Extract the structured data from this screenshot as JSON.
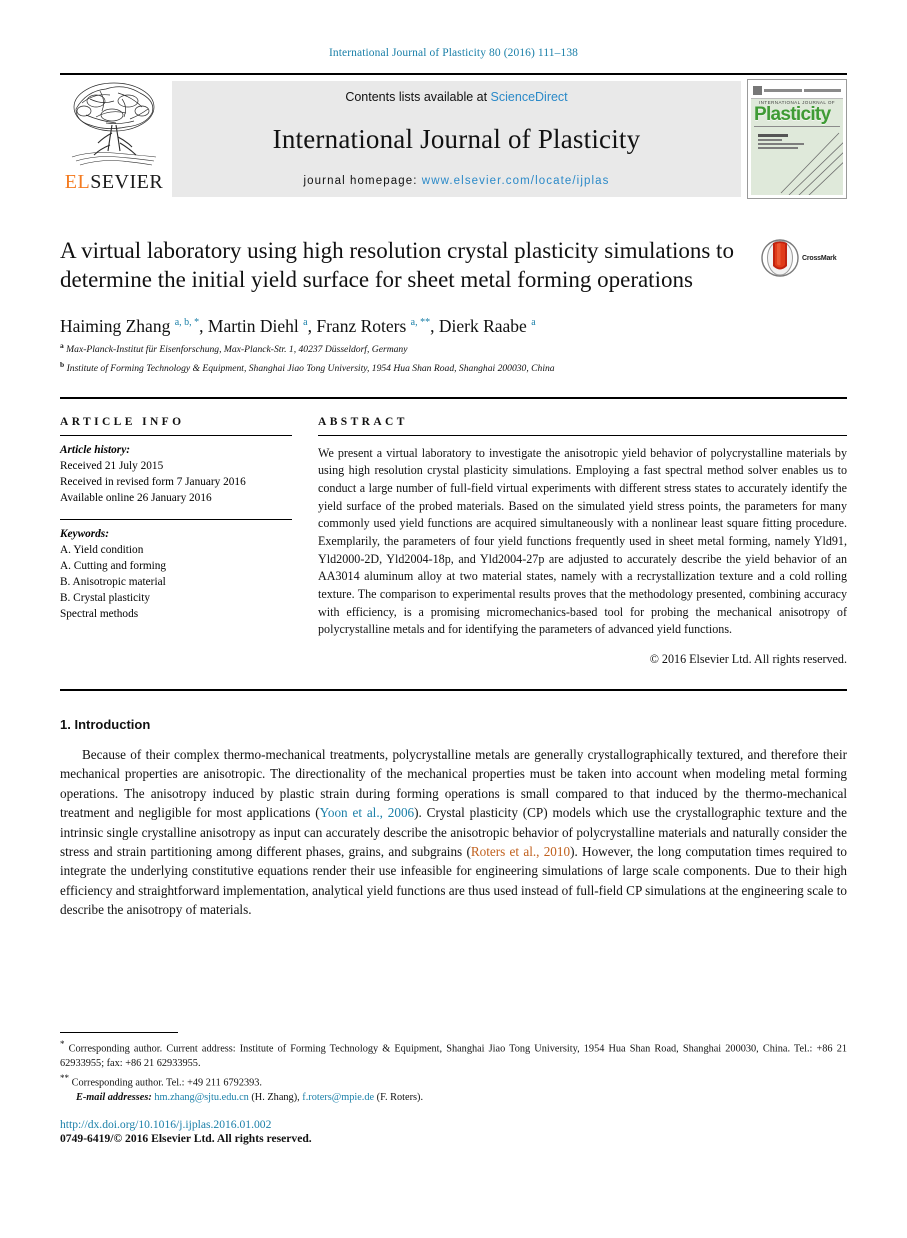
{
  "running_head": "International Journal of Plasticity 80 (2016) 111–138",
  "masthead": {
    "publisher": "ELSEVIER",
    "contents_prefix": "Contents lists available at ",
    "contents_link": "ScienceDirect",
    "journal_title": "International Journal of Plasticity",
    "homepage_prefix": "journal homepage: ",
    "homepage_url": "www.elsevier.com/locate/ijplas",
    "cover": {
      "kicker": "INTERNATIONAL JOURNAL OF",
      "name": "Plasticity"
    }
  },
  "article": {
    "title": "A virtual laboratory using high resolution crystal plasticity simulations to determine the initial yield surface for sheet metal forming operations",
    "crossmark_label": "CrossMark",
    "authors_html": "Haiming Zhang <sup>a, b, *</sup>, Martin Diehl <sup>a</sup>, Franz Roters <sup>a, **</sup>, Dierk Raabe <sup>a</sup>",
    "affiliations": [
      {
        "marker": "a",
        "text": "Max-Planck-Institut für Eisenforschung, Max-Planck-Str. 1, 40237 Düsseldorf, Germany"
      },
      {
        "marker": "b",
        "text": "Institute of Forming Technology & Equipment, Shanghai Jiao Tong University, 1954 Hua Shan Road, Shanghai 200030, China"
      }
    ]
  },
  "info": {
    "heading": "ARTICLE INFO",
    "history_label": "Article history:",
    "history": [
      "Received 21 July 2015",
      "Received in revised form 7 January 2016",
      "Available online 26 January 2016"
    ],
    "keywords_label": "Keywords:",
    "keywords": [
      "A. Yield condition",
      "A. Cutting and forming",
      "B. Anisotropic material",
      "B. Crystal plasticity",
      "Spectral methods"
    ]
  },
  "abstract": {
    "heading": "ABSTRACT",
    "text": "We present a virtual laboratory to investigate the anisotropic yield behavior of polycrystalline materials by using high resolution crystal plasticity simulations. Employing a fast spectral method solver enables us to conduct a large number of full-field virtual experiments with different stress states to accurately identify the yield surface of the probed materials. Based on the simulated yield stress points, the parameters for many commonly used yield functions are acquired simultaneously with a nonlinear least square fitting procedure. Exemplarily, the parameters of four yield functions frequently used in sheet metal forming, namely Yld91, Yld2000-2D, Yld2004-18p, and Yld2004-27p are adjusted to accurately describe the yield behavior of an AA3014 aluminum alloy at two material states, namely with a recrystallization texture and a cold rolling texture. The comparison to experimental results proves that the methodology presented, combining accuracy with efficiency, is a promising micromechanics-based tool for probing the mechanical anisotropy of polycrystalline metals and for identifying the parameters of advanced yield functions.",
    "copyright": "© 2016 Elsevier Ltd. All rights reserved."
  },
  "introduction": {
    "heading": "1. Introduction",
    "par1_a": "Because of their complex thermo-mechanical treatments, polycrystalline metals are generally crystallographically textured, and therefore their mechanical properties are anisotropic. The directionality of the mechanical properties must be taken into account when modeling metal forming operations. The anisotropy induced by plastic strain during forming operations is small compared to that induced by the thermo-mechanical treatment and negligible for most applications (",
    "cite1": "Yoon et al., 2006",
    "par1_b": "). Crystal plasticity (CP) models which use the crystallographic texture and the intrinsic single crystalline anisotropy as input can accurately describe the anisotropic behavior of polycrystalline materials and naturally consider the stress and strain partitioning among different phases, grains, and subgrains (",
    "cite2": "Roters et al., 2010",
    "par1_c": "). However, the long computation times required to integrate the underlying constitutive equations render their use infeasible for engineering simulations of large scale components. Due to their high efficiency and straightforward implementation, analytical yield functions are thus used instead of full-field CP simulations at the engineering scale to describe the anisotropy of materials."
  },
  "footnotes": {
    "corresponding_1": "Corresponding author. Current address: Institute of Forming Technology & Equipment, Shanghai Jiao Tong University, 1954 Hua Shan Road, Shanghai 200030, China. Tel.: +86 21 62933955; fax: +86 21 62933955.",
    "corresponding_2": "Corresponding author. Tel.: +49 211 6792393.",
    "email_label": "E-mail addresses:",
    "email_1": "hm.zhang@sjtu.edu.cn",
    "email_1_name": " (H. Zhang), ",
    "email_2": "f.roters@mpie.de",
    "email_2_name": " (F. Roters)."
  },
  "footer": {
    "doi": "http://dx.doi.org/10.1016/j.ijplas.2016.01.002",
    "issn": "0749-6419/© 2016 Elsevier Ltd. All rights reserved."
  },
  "colors": {
    "link_blue": "#1a7fa8",
    "sciencedirect_blue": "#2a89c8",
    "cite_orange": "#c0601d",
    "elsevier_orange": "#f47b20",
    "cover_green": "#3f9b35"
  }
}
